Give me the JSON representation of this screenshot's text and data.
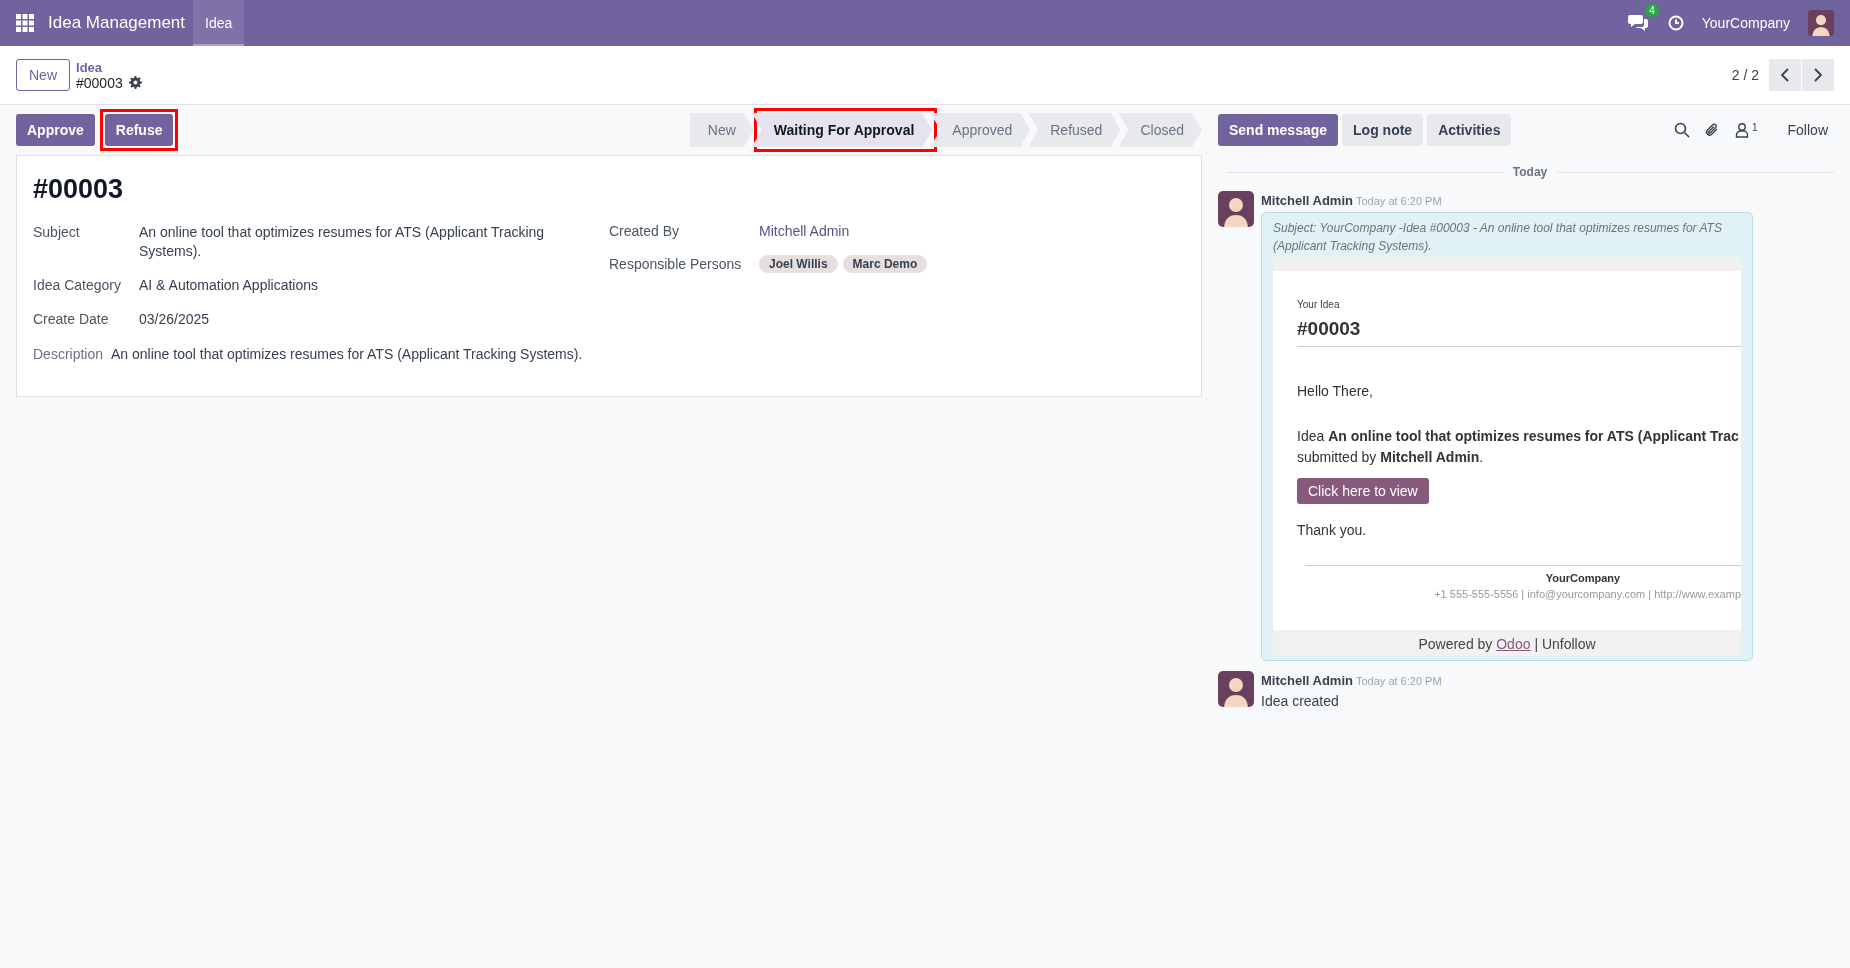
{
  "navbar": {
    "app_name": "Idea Management",
    "menus": [
      {
        "label": "Idea",
        "selected": true
      }
    ],
    "messages_badge": "4",
    "company": "YourCompany"
  },
  "control_panel": {
    "new_button": "New",
    "breadcrumb_parent": "Idea",
    "record_name": "#00003",
    "pager": "2 / 2"
  },
  "actions": [
    {
      "label": "Approve",
      "highlighted": false
    },
    {
      "label": "Refuse",
      "highlighted": true
    }
  ],
  "stages": [
    {
      "label": "New",
      "selected": false,
      "highlighted": false
    },
    {
      "label": "Waiting For Approval",
      "selected": true,
      "highlighted": true
    },
    {
      "label": "Approved",
      "selected": false,
      "highlighted": false
    },
    {
      "label": "Refused",
      "selected": false,
      "highlighted": false
    },
    {
      "label": "Closed",
      "selected": false,
      "highlighted": false
    }
  ],
  "form": {
    "title": "#00003",
    "left_fields": [
      {
        "label": "Subject",
        "value": "An online tool that optimizes resumes for ATS (Applicant Tracking Systems)."
      },
      {
        "label": "Idea Category",
        "value": "AI & Automation Applications"
      },
      {
        "label": "Create Date",
        "value": "03/26/2025"
      }
    ],
    "right_fields": [
      {
        "label": "Created By",
        "kind": "link",
        "value": "Mitchell Admin"
      },
      {
        "label": "Responsible Persons",
        "kind": "tags",
        "tags": [
          "Joel Willis",
          "Marc Demo"
        ]
      }
    ],
    "description": {
      "label": "Description",
      "value": "An online tool that optimizes resumes for ATS (Applicant Tracking Systems)."
    }
  },
  "chatter": {
    "buttons": [
      {
        "label": "Send message",
        "selected": true
      },
      {
        "label": "Log note",
        "selected": false
      },
      {
        "label": "Activities",
        "selected": false
      }
    ],
    "followers_count": "1",
    "follow": "Follow",
    "date_separator": "Today",
    "messages": [
      {
        "kind": "email",
        "author": "Mitchell Admin",
        "time": "Today at 6:20 PM",
        "subject": "Subject: YourCompany -Idea #00003 - An online tool that optimizes resumes for ATS (Applicant Tracking Systems).",
        "email": {
          "caption": "Your Idea",
          "title": "#00003",
          "greeting": "Hello There,",
          "lines": [
            "Idea **An online tool that optimizes resumes for ATS (Applicant Trac**",
            "submitted by **Mitchell Admin**."
          ],
          "button": "Click here to view",
          "thanks": "Thank you.",
          "company": "YourCompany",
          "contact": "+1 555-555-5556 | info@yourcompany.com | http://www.examp",
          "powered_by": "Powered by",
          "powered_link": "Odoo",
          "unfollow": "| Unfollow"
        }
      },
      {
        "kind": "note",
        "author": "Mitchell Admin",
        "time": "Today at 6:20 PM",
        "body": "Idea created"
      }
    ]
  }
}
